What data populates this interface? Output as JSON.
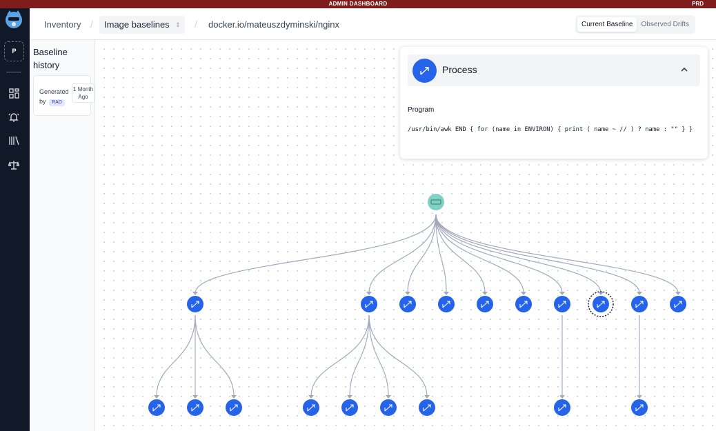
{
  "admin_bar": {
    "title": "ADMIN DASHBOARD",
    "env": "PRD"
  },
  "sidebar": {
    "org_initial": "P",
    "nav_icons": [
      "dashboard-icon",
      "alerts-bell-icon",
      "library-icon",
      "policy-scale-icon"
    ]
  },
  "breadcrumb": {
    "inventory": "Inventory",
    "baselines": "Image baselines",
    "image": "docker.io/mateuszdyminski/nginx"
  },
  "view_toggle": {
    "current": "Current Baseline",
    "drifts": "Observed Drifts",
    "active": "current"
  },
  "history": {
    "title": "Baseline history",
    "entries": [
      {
        "generated_by": "Generated by",
        "badge": "RAD",
        "age": "1 Month Ago"
      }
    ]
  },
  "details_panel": {
    "title": "Process",
    "field_label": "Program",
    "program": "/usr/bin/awk END { for (name in ENVIRON) { print ( name ~ // ) ? name : \"\" } }"
  },
  "graph": {
    "root": {
      "icon": "container-icon",
      "color": "#7fd1c4"
    },
    "node_color": "#2563eb",
    "edge_color": "#a3a8bd",
    "children": [
      {
        "icon": "process-icon",
        "children": 3
      },
      {
        "icon": "process-icon",
        "children": 4
      },
      {
        "icon": "process-icon",
        "children": 0
      },
      {
        "icon": "process-icon",
        "children": 0
      },
      {
        "icon": "process-icon",
        "children": 0
      },
      {
        "icon": "process-icon",
        "children": 0
      },
      {
        "icon": "process-icon",
        "children": 1
      },
      {
        "icon": "process-icon",
        "children": 0,
        "selected": true
      },
      {
        "icon": "process-icon",
        "children": 1
      },
      {
        "icon": "process-icon",
        "children": 0
      }
    ]
  }
}
